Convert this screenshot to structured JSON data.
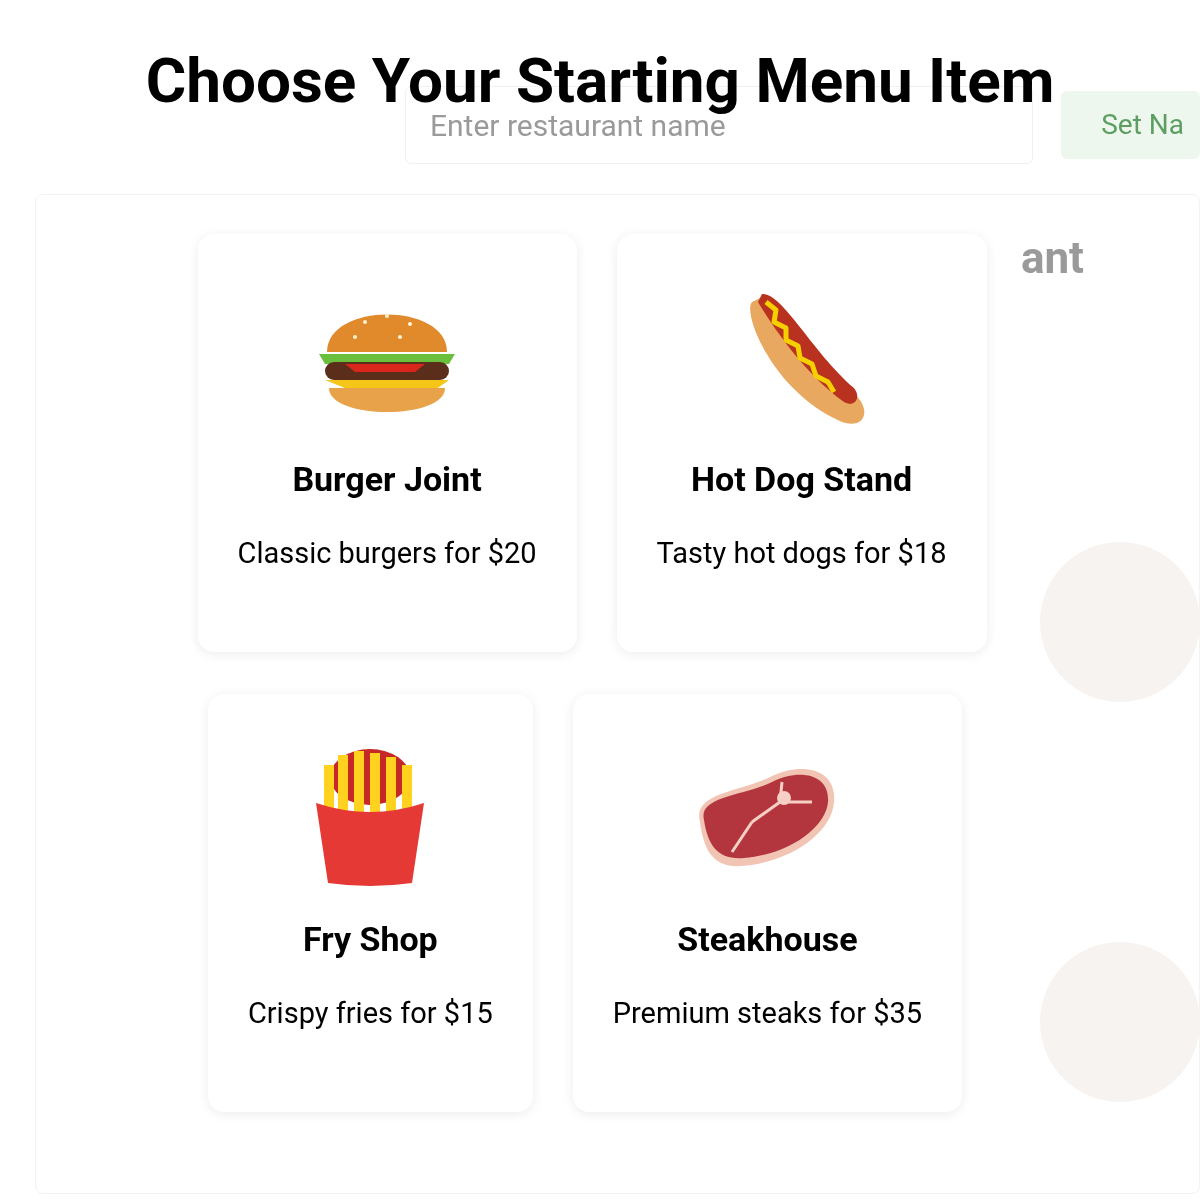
{
  "background": {
    "name_field": {
      "placeholder": "Enter restaurant name"
    },
    "set_name_button": "Set Na",
    "heading": "ant"
  },
  "dialog": {
    "title": "Choose Your Starting Menu Item",
    "options": [
      {
        "kind": "burger",
        "name": "Burger Joint",
        "description": "Classic burgers for $20"
      },
      {
        "kind": "hotdog",
        "name": "Hot Dog Stand",
        "description": "Tasty hot dogs for $18"
      },
      {
        "kind": "fries",
        "name": "Fry Shop",
        "description": "Crispy fries for $15"
      },
      {
        "kind": "steak",
        "name": "Steakhouse",
        "description": "Premium steaks for $35"
      }
    ]
  }
}
